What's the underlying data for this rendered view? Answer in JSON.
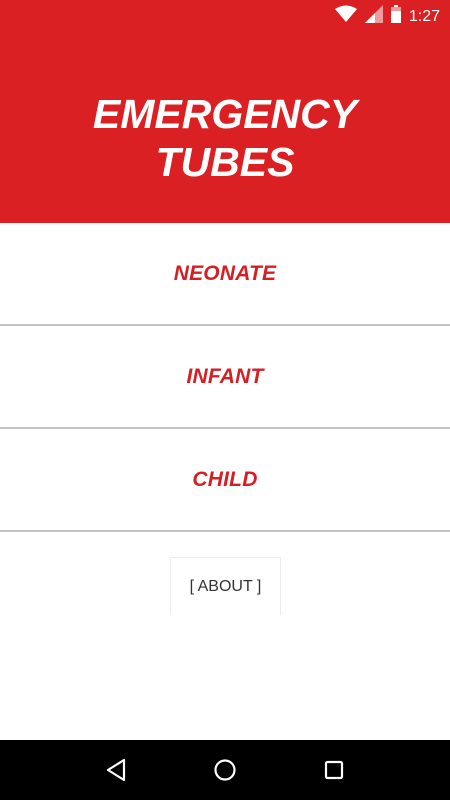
{
  "status_bar": {
    "time": "1:27",
    "icons": [
      "wifi-icon",
      "cell-signal-icon",
      "battery-icon"
    ]
  },
  "header": {
    "title_line1": "EMERGENCY",
    "title_line2": "TUBES",
    "background_color": "#db2024"
  },
  "menu": {
    "items": [
      {
        "label": "NEONATE"
      },
      {
        "label": "INFANT"
      },
      {
        "label": "CHILD"
      }
    ],
    "label_color": "#d42025"
  },
  "about": {
    "label": "[ ABOUT ]"
  },
  "nav_bar": {
    "buttons": [
      "back-icon",
      "home-icon",
      "recents-icon"
    ]
  }
}
